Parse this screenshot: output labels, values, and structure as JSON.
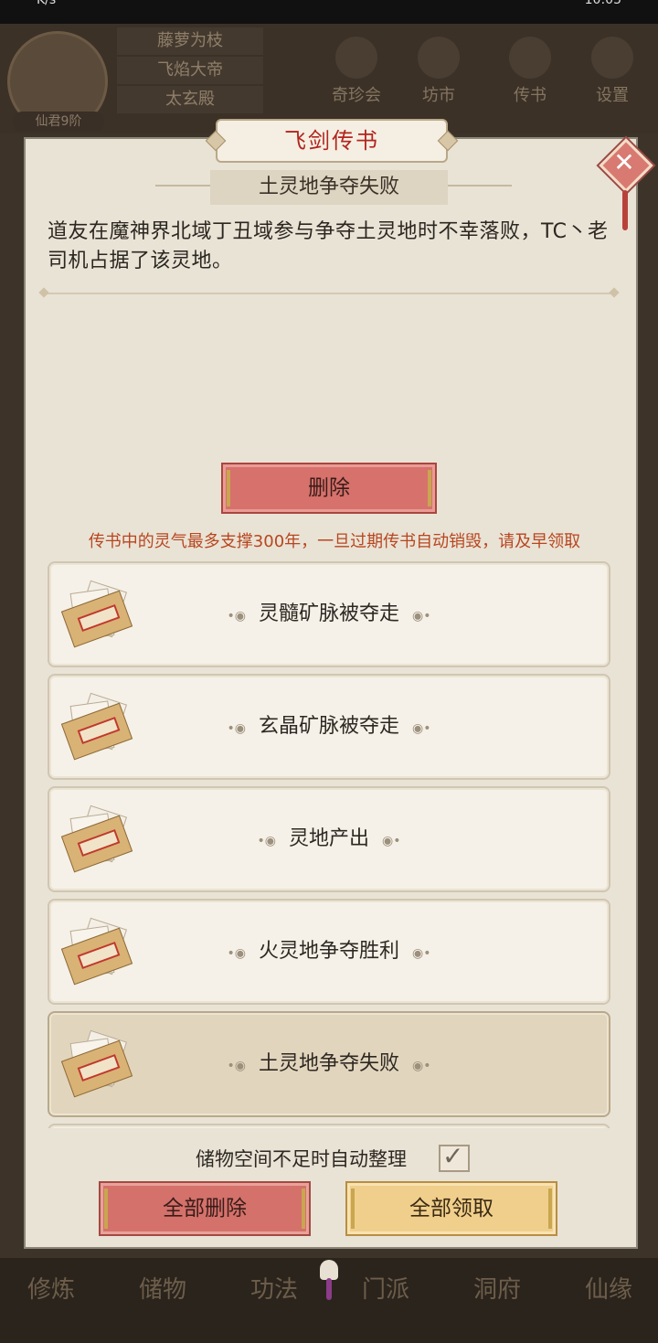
{
  "status_bar": {
    "left_text": "K/s",
    "right_text": "10:05"
  },
  "background": {
    "names": [
      "藤萝为枝",
      "飞焰大帝",
      "太玄殿"
    ],
    "level": "仙君9阶",
    "top_icons": [
      "奇珍会",
      "坊市",
      "传书",
      "设置"
    ],
    "bottom_nav": [
      "修炼",
      "储物",
      "功法",
      "门派",
      "洞府",
      "仙缘"
    ]
  },
  "modal": {
    "title": "飞剑传书",
    "message_title": "土灵地争夺失败",
    "message_body": "道友在魔神界北域丁丑域参与争夺土灵地时不幸落败，TC丶老司机占据了该灵地。",
    "delete_label": "删除",
    "notice": "传书中的灵气最多支撑300年，一旦过期传书自动销毁，请及早领取",
    "items": [
      {
        "label": "灵髓矿脉被夺走",
        "selected": false
      },
      {
        "label": "玄晶矿脉被夺走",
        "selected": false
      },
      {
        "label": "灵地产出",
        "selected": false
      },
      {
        "label": "火灵地争夺胜利",
        "selected": false
      },
      {
        "label": "土灵地争夺失败",
        "selected": true
      }
    ],
    "auto_sort_label": "储物空间不足时自动整理",
    "auto_sort_checked": true,
    "delete_all_label": "全部删除",
    "claim_all_label": "全部领取"
  },
  "icons": {
    "close": "close-icon",
    "envelope": "letter-envelope-icon",
    "check": "check-icon"
  },
  "colors": {
    "title_red": "#b3241f",
    "notice_orange": "#b8461f",
    "delete_red": "#d6716c",
    "claim_gold": "#f0cf8c",
    "selected_item": "#e2d5bd"
  }
}
